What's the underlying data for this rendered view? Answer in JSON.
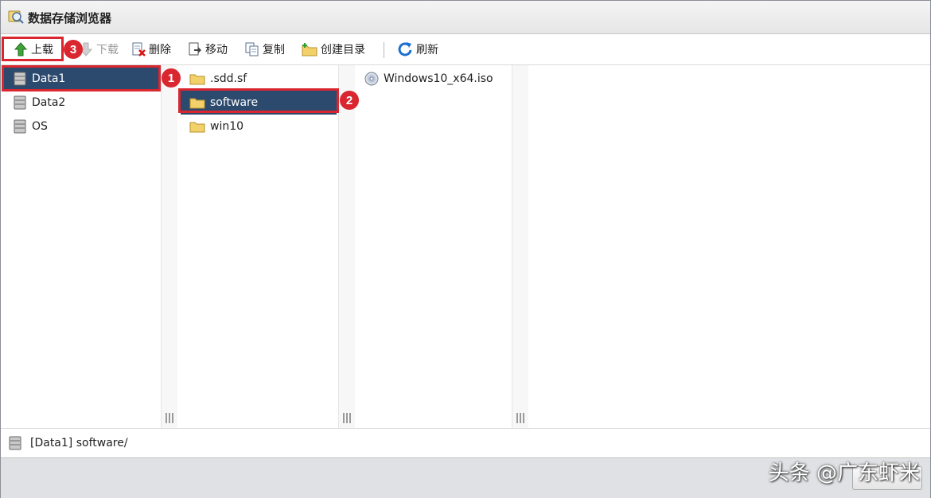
{
  "window": {
    "title": "数据存储浏览器"
  },
  "toolbar": {
    "upload": "上载",
    "download": "下载",
    "delete": "删除",
    "move": "移动",
    "copy": "复制",
    "create_dir": "创建目录",
    "refresh": "刷新"
  },
  "datastores": [
    {
      "label": "Data1",
      "selected": true
    },
    {
      "label": "Data2",
      "selected": false
    },
    {
      "label": "OS",
      "selected": false
    }
  ],
  "folders": [
    {
      "label": ".sdd.sf",
      "selected": false
    },
    {
      "label": "software",
      "selected": true
    },
    {
      "label": "win10",
      "selected": false
    }
  ],
  "files": [
    {
      "label": "Windows10_x64.iso",
      "icon": "disc-image-icon"
    }
  ],
  "status": {
    "path": "[Data1] software/"
  },
  "annotations": {
    "step1": "1",
    "step2": "2",
    "step3": "3"
  },
  "watermark": "头条 @广东虾米",
  "colors": {
    "selection": "#2c4a6e",
    "highlight": "#d9262f"
  }
}
